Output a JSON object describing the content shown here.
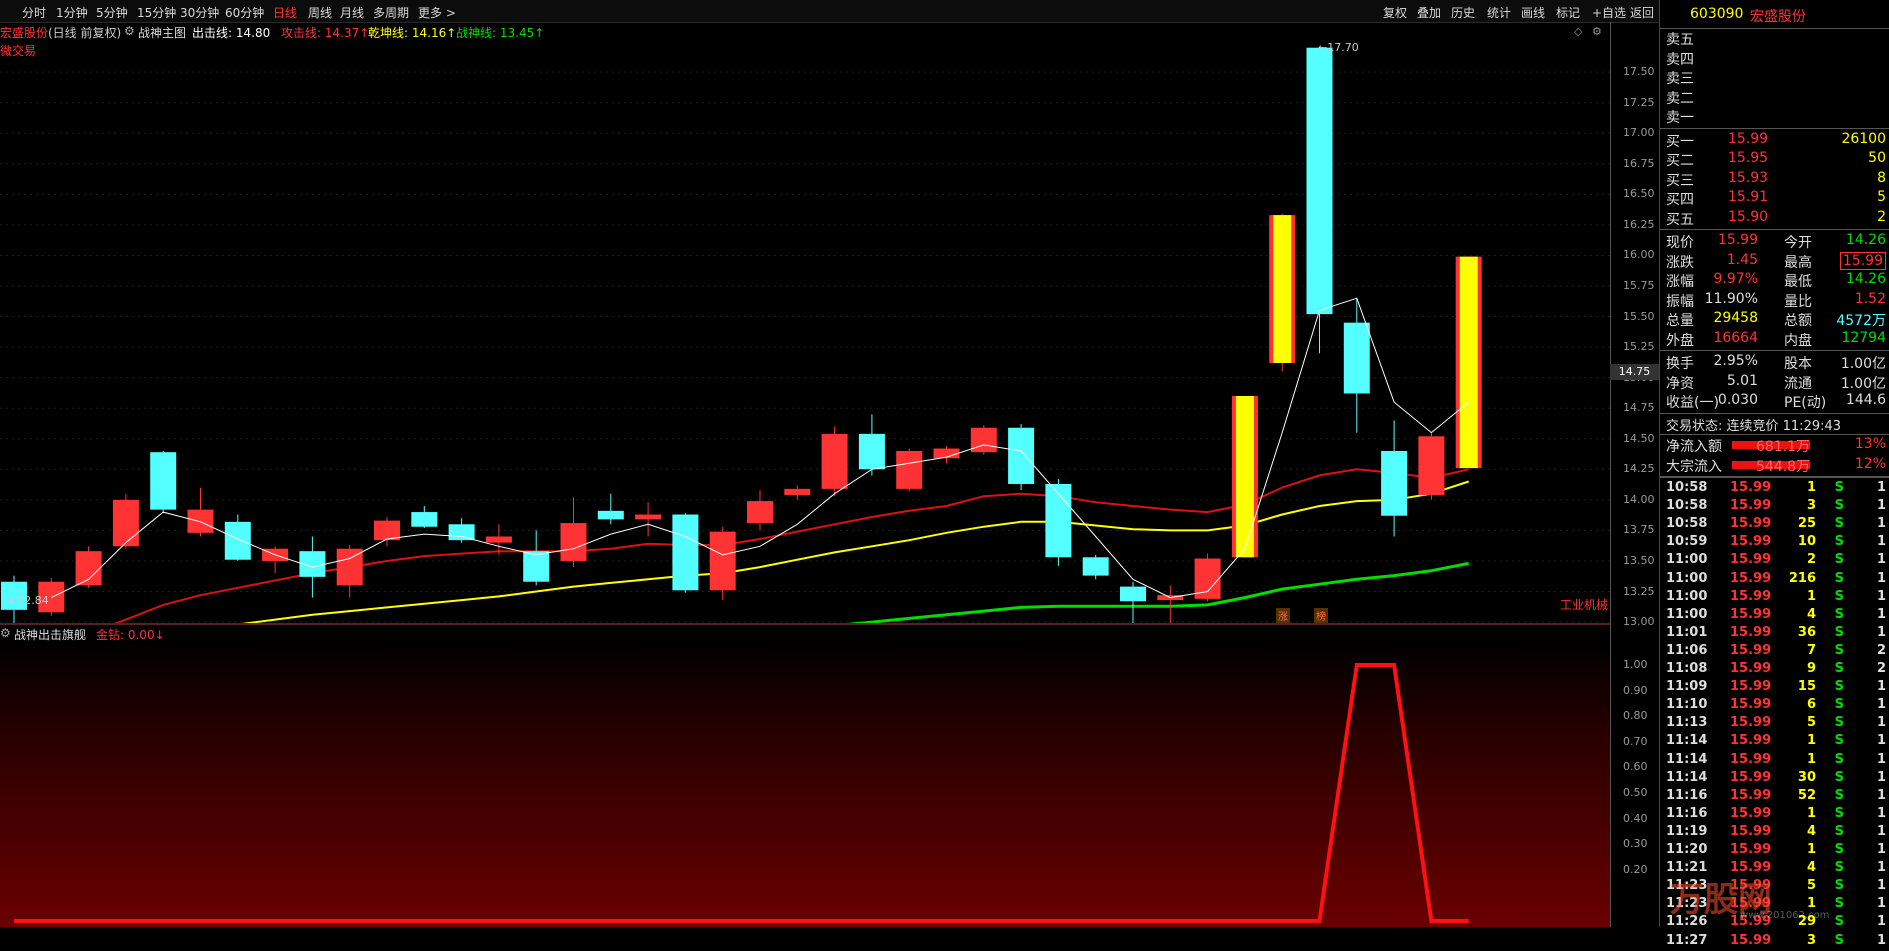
{
  "toolbar": {
    "periods": [
      "分时",
      "1分钟",
      "5分钟",
      "15分钟",
      "30分钟",
      "60分钟",
      "日线",
      "周线",
      "月线",
      "多周期",
      "更多 >"
    ],
    "active_period": "日线",
    "right_tools": [
      "复权",
      "叠加",
      "历史",
      "统计",
      "画线",
      "标记",
      "+自选",
      "返回"
    ]
  },
  "main_title": {
    "stock_name": "宏盛股份",
    "adjust": "(日线 前复权)",
    "indicator": "战神主图",
    "line1": "出击线: 14.80",
    "line2": "攻击线: 14.37↑",
    "line3": "乾坤线: 14.16↑",
    "line4": "战神线: 13.45↑",
    "tag": "微交易"
  },
  "annotations": {
    "high": "17.70",
    "low": "12.84",
    "badge1": "涨",
    "badge2": "榜",
    "sector": "工业机械",
    "price_marker": "14.75"
  },
  "sub_title": {
    "name": "战神出击旗舰",
    "value": "金钻: 0.00↓"
  },
  "colors": {
    "up": "#ff3333",
    "down": "#54ffff",
    "yellow": "#ffff00",
    "green": "#00dd00",
    "white": "#ffffff"
  },
  "chart_data": [
    {
      "type": "candlestick",
      "title": "宏盛股份 日线",
      "ylim": [
        12.75,
        17.75
      ],
      "yticks": [
        "17.50",
        "17.25",
        "17.00",
        "16.75",
        "16.50",
        "16.25",
        "16.00",
        "15.75",
        "15.50",
        "15.25",
        "15.00",
        "14.75",
        "14.50",
        "14.25",
        "14.00",
        "13.75",
        "13.50",
        "13.25",
        "13.00"
      ],
      "candles": [
        {
          "o": 13.33,
          "c": 13.1,
          "h": 13.38,
          "l": 12.95
        },
        {
          "o": 13.08,
          "c": 13.33,
          "h": 13.36,
          "l": 13.05
        },
        {
          "o": 13.3,
          "c": 13.58,
          "h": 13.62,
          "l": 13.28
        },
        {
          "o": 13.62,
          "c": 14.0,
          "h": 14.05,
          "l": 13.6
        },
        {
          "o": 14.39,
          "c": 13.92,
          "h": 14.4,
          "l": 13.89
        },
        {
          "o": 13.73,
          "c": 13.92,
          "h": 14.1,
          "l": 13.7
        },
        {
          "o": 13.82,
          "c": 13.51,
          "h": 13.88,
          "l": 13.5
        },
        {
          "o": 13.5,
          "c": 13.6,
          "h": 13.62,
          "l": 13.4
        },
        {
          "o": 13.58,
          "c": 13.37,
          "h": 13.7,
          "l": 13.2
        },
        {
          "o": 13.3,
          "c": 13.6,
          "h": 13.63,
          "l": 13.2
        },
        {
          "o": 13.67,
          "c": 13.83,
          "h": 13.86,
          "l": 13.62
        },
        {
          "o": 13.9,
          "c": 13.78,
          "h": 13.95,
          "l": 13.77
        },
        {
          "o": 13.8,
          "c": 13.67,
          "h": 13.85,
          "l": 13.65
        },
        {
          "o": 13.65,
          "c": 13.7,
          "h": 13.8,
          "l": 13.55
        },
        {
          "o": 13.58,
          "c": 13.33,
          "h": 13.75,
          "l": 13.3
        },
        {
          "o": 13.5,
          "c": 13.81,
          "h": 14.02,
          "l": 13.45
        },
        {
          "o": 13.91,
          "c": 13.84,
          "h": 14.05,
          "l": 13.8
        },
        {
          "o": 13.84,
          "c": 13.88,
          "h": 13.98,
          "l": 13.7
        },
        {
          "o": 13.88,
          "c": 13.26,
          "h": 13.89,
          "l": 13.24
        },
        {
          "o": 13.26,
          "c": 13.74,
          "h": 13.78,
          "l": 13.18
        },
        {
          "o": 13.81,
          "c": 13.99,
          "h": 14.08,
          "l": 13.75
        },
        {
          "o": 14.04,
          "c": 14.09,
          "h": 14.12,
          "l": 14.0
        },
        {
          "o": 14.09,
          "c": 14.54,
          "h": 14.6,
          "l": 14.03
        },
        {
          "o": 14.54,
          "c": 14.25,
          "h": 14.7,
          "l": 14.2
        },
        {
          "o": 14.09,
          "c": 14.4,
          "h": 14.42,
          "l": 14.07
        },
        {
          "o": 14.34,
          "c": 14.42,
          "h": 14.44,
          "l": 14.3
        },
        {
          "o": 14.39,
          "c": 14.59,
          "h": 14.61,
          "l": 14.37
        },
        {
          "o": 14.59,
          "c": 14.13,
          "h": 14.62,
          "l": 14.08
        },
        {
          "o": 14.13,
          "c": 13.53,
          "h": 14.17,
          "l": 13.46
        },
        {
          "o": 13.53,
          "c": 13.38,
          "h": 13.55,
          "l": 13.35
        },
        {
          "o": 13.29,
          "c": 13.17,
          "h": 13.33,
          "l": 12.95
        },
        {
          "o": 13.18,
          "c": 13.22,
          "h": 13.3,
          "l": 12.98
        },
        {
          "o": 13.19,
          "c": 13.52,
          "h": 13.56,
          "l": 13.17
        },
        {
          "o": 13.53,
          "c": 14.85,
          "h": 14.85,
          "l": 13.53
        },
        {
          "o": 15.12,
          "c": 16.33,
          "h": 16.34,
          "l": 15.05
        },
        {
          "o": 17.7,
          "c": 15.52,
          "h": 17.7,
          "l": 15.2
        },
        {
          "o": 15.45,
          "c": 14.87,
          "h": 15.65,
          "l": 14.55
        },
        {
          "o": 14.4,
          "c": 13.87,
          "h": 14.65,
          "l": 13.7
        },
        {
          "o": 14.04,
          "c": 14.52,
          "h": 14.55,
          "l": 14.0
        },
        {
          "o": 14.26,
          "c": 15.99,
          "h": 15.99,
          "l": 14.26
        }
      ],
      "ma_white": [
        null,
        13.2,
        13.35,
        13.65,
        13.9,
        13.82,
        13.68,
        13.55,
        13.45,
        13.52,
        13.68,
        13.72,
        13.7,
        13.62,
        13.55,
        13.6,
        13.72,
        13.8,
        13.7,
        13.55,
        13.62,
        13.8,
        14.05,
        14.25,
        14.3,
        14.35,
        14.45,
        14.4,
        14.05,
        13.7,
        13.35,
        13.2,
        13.25,
        13.6,
        14.55,
        15.55,
        15.65,
        14.8,
        14.55,
        14.8
      ],
      "ma_red": [
        null,
        null,
        12.9,
        13.02,
        13.14,
        13.22,
        13.28,
        13.34,
        13.4,
        13.45,
        13.5,
        13.54,
        13.56,
        13.58,
        13.58,
        13.58,
        13.6,
        13.64,
        13.63,
        13.63,
        13.68,
        13.74,
        13.8,
        13.86,
        13.91,
        13.95,
        14.03,
        14.05,
        14.03,
        13.98,
        13.95,
        13.92,
        13.9,
        13.96,
        14.1,
        14.2,
        14.25,
        14.22,
        14.18,
        14.25
      ],
      "ma_yellow": [
        null,
        null,
        null,
        null,
        null,
        null,
        12.98,
        13.02,
        13.06,
        13.09,
        13.12,
        13.15,
        13.18,
        13.21,
        13.25,
        13.29,
        13.32,
        13.35,
        13.38,
        13.4,
        13.45,
        13.51,
        13.57,
        13.62,
        13.67,
        13.73,
        13.78,
        13.82,
        13.82,
        13.79,
        13.76,
        13.75,
        13.75,
        13.79,
        13.88,
        13.95,
        13.99,
        14.0,
        14.05,
        14.15
      ],
      "ma_green": [
        null,
        null,
        null,
        null,
        12.85,
        12.85,
        12.86,
        12.85,
        null,
        null,
        null,
        null,
        null,
        null,
        null,
        null,
        12.85,
        12.87,
        12.88,
        12.9,
        12.93,
        12.95,
        12.97,
        13.0,
        13.03,
        13.06,
        13.09,
        13.12,
        13.13,
        13.13,
        13.13,
        13.13,
        13.14,
        13.2,
        13.27,
        13.31,
        13.35,
        13.38,
        13.42,
        13.48
      ]
    },
    {
      "type": "line",
      "title": "战神出击旗舰",
      "ylim": [
        0,
        1.1
      ],
      "yticks": [
        "1.00",
        "0.90",
        "0.80",
        "0.70",
        "0.60",
        "0.50",
        "0.40",
        "0.30",
        "0.20"
      ],
      "values": [
        0,
        0,
        0,
        0,
        0,
        0,
        0,
        0,
        0,
        0,
        0,
        0,
        0,
        0,
        0,
        0,
        0,
        0,
        0,
        0,
        0,
        0,
        0,
        0,
        0,
        0,
        0,
        0,
        0,
        0,
        0,
        0,
        0,
        0,
        0,
        0,
        1,
        1,
        0,
        0
      ]
    }
  ],
  "side": {
    "code": "603090",
    "name": "宏盛股份",
    "asks": [
      {
        "label": "卖五",
        "price": "",
        "vol": ""
      },
      {
        "label": "卖四",
        "price": "",
        "vol": ""
      },
      {
        "label": "卖三",
        "price": "",
        "vol": ""
      },
      {
        "label": "卖二",
        "price": "",
        "vol": ""
      },
      {
        "label": "卖一",
        "price": "",
        "vol": ""
      }
    ],
    "bids": [
      {
        "label": "买一",
        "price": "15.99",
        "vol": "26100"
      },
      {
        "label": "买二",
        "price": "15.95",
        "vol": "50"
      },
      {
        "label": "买三",
        "price": "15.93",
        "vol": "8"
      },
      {
        "label": "买四",
        "price": "15.91",
        "vol": "5"
      },
      {
        "label": "买五",
        "price": "15.90",
        "vol": "2"
      }
    ],
    "stats": [
      {
        "l1": "现价",
        "v1": "15.99",
        "c1": "#ff3333",
        "l2": "今开",
        "v2": "14.26",
        "c2": "#00dd00"
      },
      {
        "l1": "涨跌",
        "v1": "1.45",
        "c1": "#ff3333",
        "l2": "最高",
        "v2": "15.99",
        "c2": "#ff3333"
      },
      {
        "l1": "涨幅",
        "v1": "9.97%",
        "c1": "#ff3333",
        "l2": "最低",
        "v2": "14.26",
        "c2": "#00dd00"
      },
      {
        "l1": "振幅",
        "v1": "11.90%",
        "c1": "#dddddd",
        "l2": "量比",
        "v2": "1.52",
        "c2": "#ff3333"
      },
      {
        "l1": "总量",
        "v1": "29458",
        "c1": "#ffff00",
        "l2": "总额",
        "v2": "4572万",
        "c2": "#54ffff"
      },
      {
        "l1": "外盘",
        "v1": "16664",
        "c1": "#ff3333",
        "l2": "内盘",
        "v2": "12794",
        "c2": "#00dd00"
      }
    ],
    "stats2": [
      {
        "l1": "换手",
        "v1": "2.95%",
        "l2": "股本",
        "v2": "1.00亿"
      },
      {
        "l1": "净资",
        "v1": "5.01",
        "l2": "流通",
        "v2": "1.00亿"
      },
      {
        "l1": "收益(一)",
        "v1": "0.030",
        "l2": "PE(动)",
        "v2": "144.6"
      }
    ],
    "status": "交易状态: 连续竞价 11:29:43",
    "flows": [
      {
        "label": "净流入额",
        "value": "681.1万",
        "pct": "13%"
      },
      {
        "label": "大宗流入",
        "value": "544.8万",
        "pct": "12%"
      }
    ],
    "ticks": [
      {
        "t": "10:58",
        "p": "15.99",
        "v": "1",
        "s": "S",
        "n": "1"
      },
      {
        "t": "10:58",
        "p": "15.99",
        "v": "3",
        "s": "S",
        "n": "1"
      },
      {
        "t": "10:58",
        "p": "15.99",
        "v": "25",
        "s": "S",
        "n": "1"
      },
      {
        "t": "10:59",
        "p": "15.99",
        "v": "10",
        "s": "S",
        "n": "1"
      },
      {
        "t": "11:00",
        "p": "15.99",
        "v": "2",
        "s": "S",
        "n": "1"
      },
      {
        "t": "11:00",
        "p": "15.99",
        "v": "216",
        "s": "S",
        "n": "1"
      },
      {
        "t": "11:00",
        "p": "15.99",
        "v": "1",
        "s": "S",
        "n": "1"
      },
      {
        "t": "11:00",
        "p": "15.99",
        "v": "4",
        "s": "S",
        "n": "1"
      },
      {
        "t": "11:01",
        "p": "15.99",
        "v": "36",
        "s": "S",
        "n": "1"
      },
      {
        "t": "11:06",
        "p": "15.99",
        "v": "7",
        "s": "S",
        "n": "2"
      },
      {
        "t": "11:08",
        "p": "15.99",
        "v": "9",
        "s": "S",
        "n": "2"
      },
      {
        "t": "11:09",
        "p": "15.99",
        "v": "15",
        "s": "S",
        "n": "1"
      },
      {
        "t": "11:10",
        "p": "15.99",
        "v": "6",
        "s": "S",
        "n": "1"
      },
      {
        "t": "11:13",
        "p": "15.99",
        "v": "5",
        "s": "S",
        "n": "1"
      },
      {
        "t": "11:14",
        "p": "15.99",
        "v": "1",
        "s": "S",
        "n": "1"
      },
      {
        "t": "11:14",
        "p": "15.99",
        "v": "1",
        "s": "S",
        "n": "1"
      },
      {
        "t": "11:14",
        "p": "15.99",
        "v": "30",
        "s": "S",
        "n": "1"
      },
      {
        "t": "11:16",
        "p": "15.99",
        "v": "52",
        "s": "S",
        "n": "1"
      },
      {
        "t": "11:16",
        "p": "15.99",
        "v": "1",
        "s": "S",
        "n": "1"
      },
      {
        "t": "11:19",
        "p": "15.99",
        "v": "4",
        "s": "S",
        "n": "1"
      },
      {
        "t": "11:20",
        "p": "15.99",
        "v": "1",
        "s": "S",
        "n": "1"
      },
      {
        "t": "11:21",
        "p": "15.99",
        "v": "4",
        "s": "S",
        "n": "1"
      },
      {
        "t": "11:23",
        "p": "15.99",
        "v": "5",
        "s": "S",
        "n": "1"
      },
      {
        "t": "11:23",
        "p": "15.99",
        "v": "1",
        "s": "S",
        "n": "1"
      },
      {
        "t": "11:26",
        "p": "15.99",
        "v": "29",
        "s": "S",
        "n": "1"
      },
      {
        "t": "11:27",
        "p": "15.99",
        "v": "3",
        "s": "S",
        "n": "1"
      }
    ],
    "watermark": "万股网",
    "watermark_sub": "www.201062.com"
  }
}
